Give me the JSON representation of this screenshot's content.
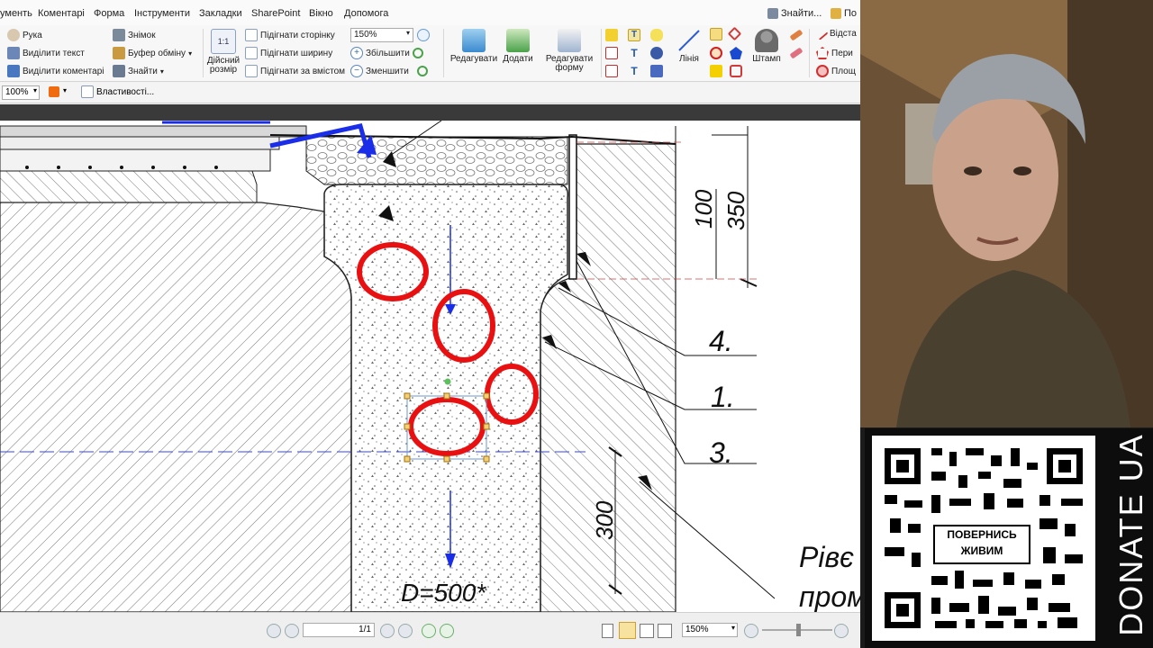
{
  "menu": [
    "ументь",
    "Коментарі",
    "Форма",
    "Інструменти",
    "Закладки",
    "SharePoint",
    "Вікно",
    "Допомога"
  ],
  "menu_right": {
    "find": "Знайти...",
    "more": "По"
  },
  "ribbon": {
    "hand": "Рука",
    "select_text": "Виділити текст",
    "select_comments": "Виділити коментарі",
    "snapshot": "Знімок",
    "clipboard": "Буфер обміну",
    "find": "Знайти",
    "actual_size_l1": "Дійсний",
    "actual_size_l2": "розмір",
    "fit_page": "Підігнати сторінку",
    "fit_width": "Підігнати ширину",
    "fit_content": "Підігнати за вмістом",
    "zoom_value": "150%",
    "zoom_in": "Збільшити",
    "zoom_out": "Зменшити",
    "edit": "Редагувати",
    "add": "Додати",
    "edit_form_l1": "Редагувати",
    "edit_form_l2": "форму",
    "line": "Лінія",
    "stamp": "Штамп",
    "distance": "Відста",
    "perimeter": "Пери",
    "area": "Площ"
  },
  "toolbar2": {
    "zoom": "100%",
    "properties": "Властивості..."
  },
  "drawing": {
    "dim_100": "100",
    "dim_350": "350",
    "dim_300": "300",
    "label_4": "4.",
    "label_1": "1.",
    "label_3": "3.",
    "diameter": "D=500*",
    "note_l1": "Рівє",
    "note_l2": "пром"
  },
  "status": {
    "page": "1/1",
    "zoom": "150%"
  },
  "donate": {
    "badge_l1": "ПОВЕРНИСЬ",
    "badge_l2": "ЖИВИМ",
    "text": "DONATE UA"
  },
  "colors": {
    "annotation_red": "#e81010",
    "arrow_blue": "#1a2eea",
    "accent_dark": "#3a3a3a"
  }
}
